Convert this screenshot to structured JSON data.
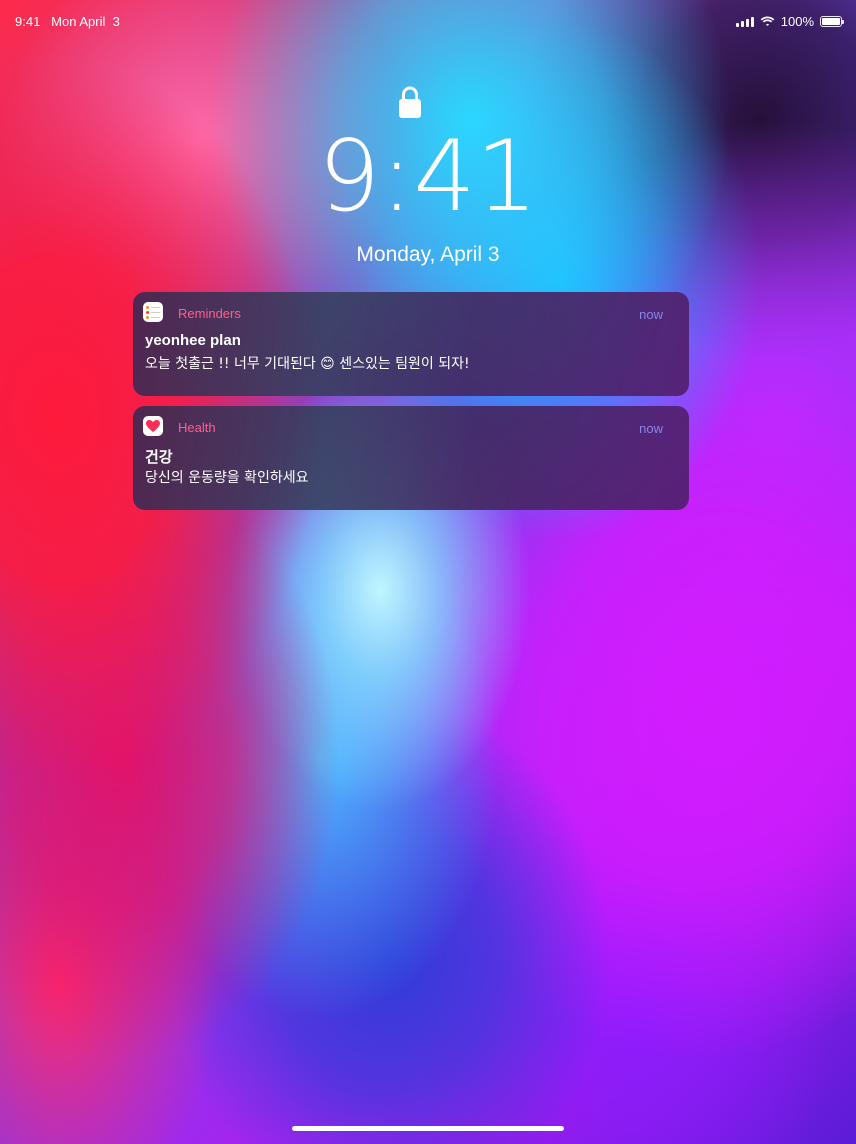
{
  "status_bar": {
    "time": "9:41",
    "date": "Mon April  3",
    "battery_percent": "100%",
    "battery_level": 1.0,
    "icons": [
      "signal-icon",
      "wifi-icon",
      "battery-icon"
    ]
  },
  "lock_screen": {
    "lock_icon": "lock-icon",
    "time": "9:41",
    "date": "Monday, April 3"
  },
  "notifications": [
    {
      "app": "Reminders",
      "app_icon": "reminders-app-icon",
      "time": "now",
      "title": "yeonhee plan",
      "body": "오늘 첫출근 !! 너무 기대된다 😊 센스있는 팀원이 되자!"
    },
    {
      "app": "Health",
      "app_icon": "health-app-icon",
      "time": "now",
      "title": "건강",
      "body": "당신의 운동량을 확인하세요"
    }
  ],
  "colors": {
    "app_name": "#ff5f8e",
    "notif_time": "#8a86e6",
    "health_heart": "#ff2d55"
  }
}
